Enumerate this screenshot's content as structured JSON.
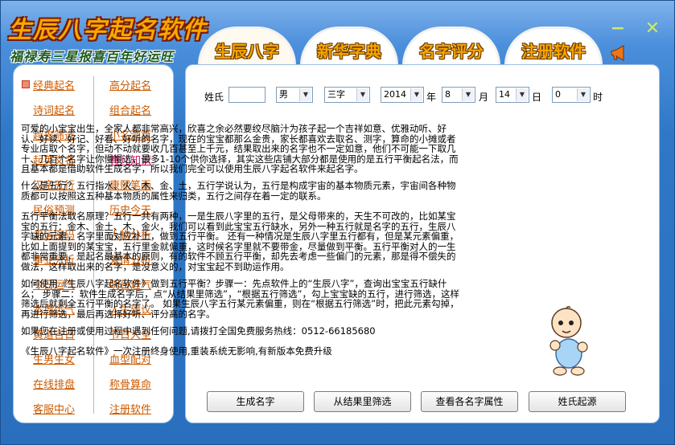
{
  "app": {
    "title": "生辰八字起名软件",
    "slogan": "福禄寿三星报喜百年好运旺",
    "minimize": "−",
    "close": "✕"
  },
  "icons": {
    "minimize": "minimize-icon",
    "close": "close-icon",
    "speaker": "speaker-icon",
    "bullet": "bullet-icon",
    "mascot": "baby-mascot-illustration"
  },
  "tabs": [
    "生辰八字",
    "新华字典",
    "名字评分",
    "注册软件"
  ],
  "sidebar": {
    "left": [
      "经典起名",
      "诗词起名",
      "超吉筛选",
      "起英文名",
      "汉字五行",
      "民俗预测",
      "幸运密码",
      "事业分析",
      "今日运气",
      "本周运气",
      "黄道吉日",
      "生男生女",
      "在线排盘",
      "客服中心"
    ],
    "right": [
      "高分起名",
      "组合起名",
      "小名测算",
      "育儿知识",
      "康熙笔画",
      "历史今天",
      "人物分析",
      "爱情分析",
      "明日运气",
      "人生建议",
      "节日大全",
      "血型配对",
      "称骨算命",
      "注册软件"
    ]
  },
  "form": {
    "surname_label": "姓氏",
    "surname_value": "",
    "gender": "男",
    "name_length": "三字",
    "year": "2014",
    "year_unit": "年",
    "month": "8",
    "month_unit": "月",
    "day": "14",
    "day_unit": "日",
    "hour": "0",
    "hour_unit": "时"
  },
  "paragraphs": [
    "可爱的小宝宝出生，全家人都非常高兴，欣喜之余必然要绞尽脑汁为孩子起一个吉祥如意、优雅动听、好认、好读、好记、好看、好听的名字，现在的宝宝都那么金贵，家长都喜欢去取名、测字，算命的小摊或者专业店取个名字，但动不动就要收几百甚至上千元，结果取出来的名字也不一定如意，他们不可能一下取几十、几百个名字让你慢慢选，最多1-10个供你选择，其实这些店铺大部分都是使用的是五行平衡起名法，而且基本都是借助软件生成名字，所以我们完全可以使用生辰八字起名软件来起名字。",
    "什么是五行？五行指水、火、木、金、土，五行学说认为，五行是构成宇宙的基本物质元素，宇宙间各种物质都可以按照这五种基本物质的属性来归类，五行之间存在着一定的联系。",
    "五行平衡法取名原理？五行一共有两种，一是生辰八字里的五行，是父母带来的，天生不可改的，比如某宝宝的五行：金木、金土、木、金火，我们可以看到此宝宝五行缺水，另外一种五行就是名字的五行，生辰八字缺的元素，名字里面对应补上，做到五行平衡。 还有一种情况是生辰八字里五行都有，但是某元素偏重，比如上面提到的某宝宝，五行里金就偏重，这时候名字里就不要带金，尽量做到平衡。五行平衡对人的一生都非常重要，是起名最基本的原则，有的软件不顾五行平衡，却先去考虑一些偏门的元素，那是得不偿失的做法，这样取出来的名字，是没意义的，对宝宝起不到助运作用。",
    "如何使用《生辰八字起名软件》做到五行平衡？步骤一：先点软件上的“生辰八字”，查询出宝宝五行缺什么； 步骤二：软件生成名字后，点“从结果里筛选”，“根据五行筛选”，勾上宝宝缺的五行，进行筛选，这样筛选后就剩全五行平衡的名字了。 如果生辰八字五行某元素偏重，则在“根据五行筛选”时，把此元素勾掉，再进行筛选，最后再选择好听、评分高的名字。",
    "如果您在注册或使用过程中遇到任何问题,请拨打全国免费服务热线：0512-66185680",
    "《生辰八字起名软件》一次注册终身使用,重装系统无影响,有新版本免费升级"
  ],
  "buttons": [
    "生成名字",
    "从结果里筛选",
    "查看各名字属性",
    "姓氏起源"
  ]
}
